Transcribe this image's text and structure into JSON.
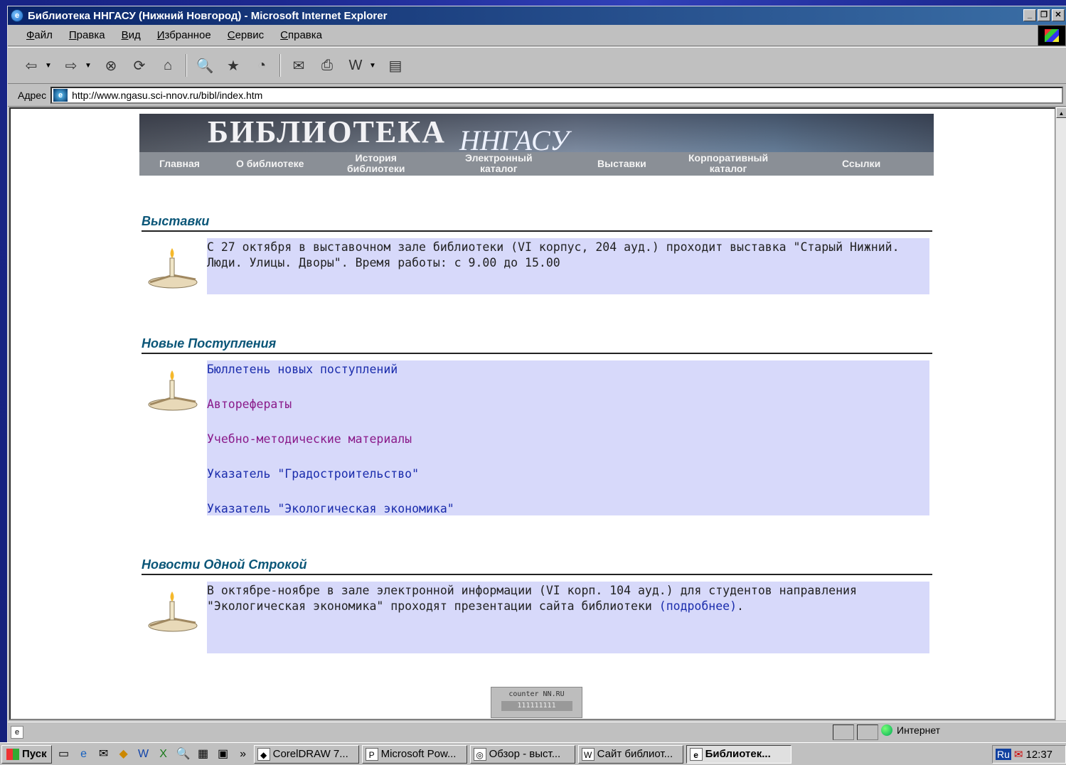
{
  "window": {
    "title": "Библиотека ННГАСУ (Нижний Новгород) - Microsoft Internet Explorer",
    "controls": [
      "_",
      "❐",
      "✕"
    ]
  },
  "menu": {
    "items": [
      "Файл",
      "Правка",
      "Вид",
      "Избранное",
      "Сервис",
      "Справка"
    ]
  },
  "toolbar": {
    "buttons": [
      {
        "name": "back-icon",
        "glyph": "⇦"
      },
      {
        "name": "forward-icon",
        "glyph": "⇨"
      },
      {
        "name": "stop-icon",
        "glyph": "⊗"
      },
      {
        "name": "refresh-icon",
        "glyph": "⟳"
      },
      {
        "name": "home-icon",
        "glyph": "⌂"
      },
      {
        "name": "search-icon",
        "glyph": "🔍"
      },
      {
        "name": "favorites-icon",
        "glyph": "★"
      },
      {
        "name": "history-icon",
        "glyph": "◔"
      },
      {
        "name": "mail-icon",
        "glyph": "✉"
      },
      {
        "name": "print-icon",
        "glyph": "⎙"
      },
      {
        "name": "edit-icon",
        "glyph": "W"
      },
      {
        "name": "discuss-icon",
        "glyph": "▤"
      }
    ]
  },
  "address": {
    "label": "Адрес",
    "url": "http://www.ngasu.sci-nnov.ru/bibl/index.htm"
  },
  "banner": {
    "title": "БИБЛИОТЕКА",
    "subtitle": "ННГАСУ",
    "nav": [
      {
        "label": "Главная"
      },
      {
        "label": "О библиотеке"
      },
      {
        "label": "История\nбиблиотеки"
      },
      {
        "label": "Электронный\nкаталог"
      },
      {
        "label": "Выставки"
      },
      {
        "label": "Корпоративный\nкаталог"
      },
      {
        "label": "Ссылки"
      }
    ]
  },
  "sections": {
    "exhibitions": {
      "heading": "Выставки",
      "text": "С 27 октября в выставочном зале библиотеки (VI корпус, 204 ауд.) проходит выставка \"Старый Нижний. Люди. Улицы. Дворы\". Время работы: с 9.00 до 15.00"
    },
    "new_arrivals": {
      "heading": "Новые Поступления",
      "links": [
        {
          "label": "Бюллетень новых поступлений",
          "visited": false
        },
        {
          "label": "Автореферат ы",
          "visited": true
        },
        {
          "label": "Учебно-методические материалы",
          "visited": true
        },
        {
          "label": "Указатель \"Градостроительство\"",
          "visited": false
        },
        {
          "label": "Указатель \"Экологическая экономика\"",
          "visited": false
        }
      ]
    },
    "news": {
      "heading": "Новости Одной Строкой",
      "text": "В октябре-ноябре в зале электронной информации (VI корп. 104 ауд.) для студентов направления \"Экологическая экономика\" проходят презентации сайта библиотеки ",
      "link": "(подробнее)",
      "after": "."
    }
  },
  "counter": {
    "top": "counter NN.RU",
    "bottom": "111111111"
  },
  "status": {
    "zone": "Интернет"
  },
  "taskbar": {
    "start": "Пуск",
    "more": "»",
    "tasks": [
      {
        "label": "CorelDRAW 7...",
        "icon": "◆",
        "active": false
      },
      {
        "label": "Microsoft Pow...",
        "icon": "P",
        "active": false
      },
      {
        "label": "Обзор - выст...",
        "icon": "◎",
        "active": false
      },
      {
        "label": "Сайт библиот...",
        "icon": "W",
        "active": false
      },
      {
        "label": "Библиотек...",
        "icon": "e",
        "active": true
      }
    ],
    "tray": {
      "lang": "Ru",
      "time": "12:37"
    }
  }
}
